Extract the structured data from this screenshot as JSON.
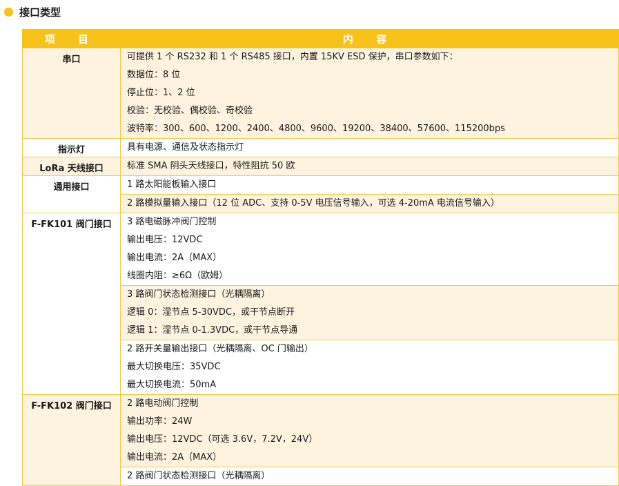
{
  "section": {
    "title": "接口类型"
  },
  "table": {
    "header": {
      "item": "项 目",
      "content": "内 容"
    },
    "serial": {
      "label": "串口",
      "lines": [
        "可提供 1 个 RS232 和 1 个 RS485 接口，内置 15KV ESD 保护，串口参数如下：",
        "数据位：8 位",
        "停止位：1、2 位",
        "校验：无校验、偶校验、奇校验",
        "波特率：300、600、1200、2400、4800、9600、19200、38400、57600、115200bps"
      ]
    },
    "indicator": {
      "label": "指示灯",
      "text": "具有电源、通信及状态指示灯"
    },
    "lora": {
      "label": "LoRa 天线接口",
      "text": "标准 SMA 阴头天线接口，特性阻抗 50 欧"
    },
    "general": {
      "label": "通用接口",
      "line1": "1 路太阳能板输入接口",
      "line2": "2 路模拟量输入接口（12 位 ADC、支持 0-5V 电压信号输入，可选 4-20mA 电流信号输入）"
    },
    "fk101": {
      "label": "F-FK101 阀门接口",
      "groups": [
        [
          "3 路电磁脉冲阀门控制",
          "输出电压：12VDC",
          "输出电流：2A（MAX）",
          "线圈内阻：≥6Ω（欧姆）"
        ],
        [
          "3 路阀门状态检测接口（光耦隔离）",
          "逻辑 0：湿节点 5-30VDC，或干节点断开",
          "逻辑 1：湿节点 0-1.3VDC，或干节点导通"
        ],
        [
          "2 路开关量输出接口（光耦隔离、OC 门输出）",
          "最大切换电压：35VDC",
          "最大切换电流：50mA"
        ]
      ]
    },
    "fk102": {
      "label": "F-FK102 阀门接口",
      "groups": [
        [
          "2 路电动阀门控制",
          "输出功率：24W",
          "输出电压：12VDC（可选 3.6V，7.2V，24V）",
          "输出电流：2A（MAX）"
        ],
        [
          "2 路阀门状态检测接口（光耦隔离）"
        ]
      ]
    }
  }
}
